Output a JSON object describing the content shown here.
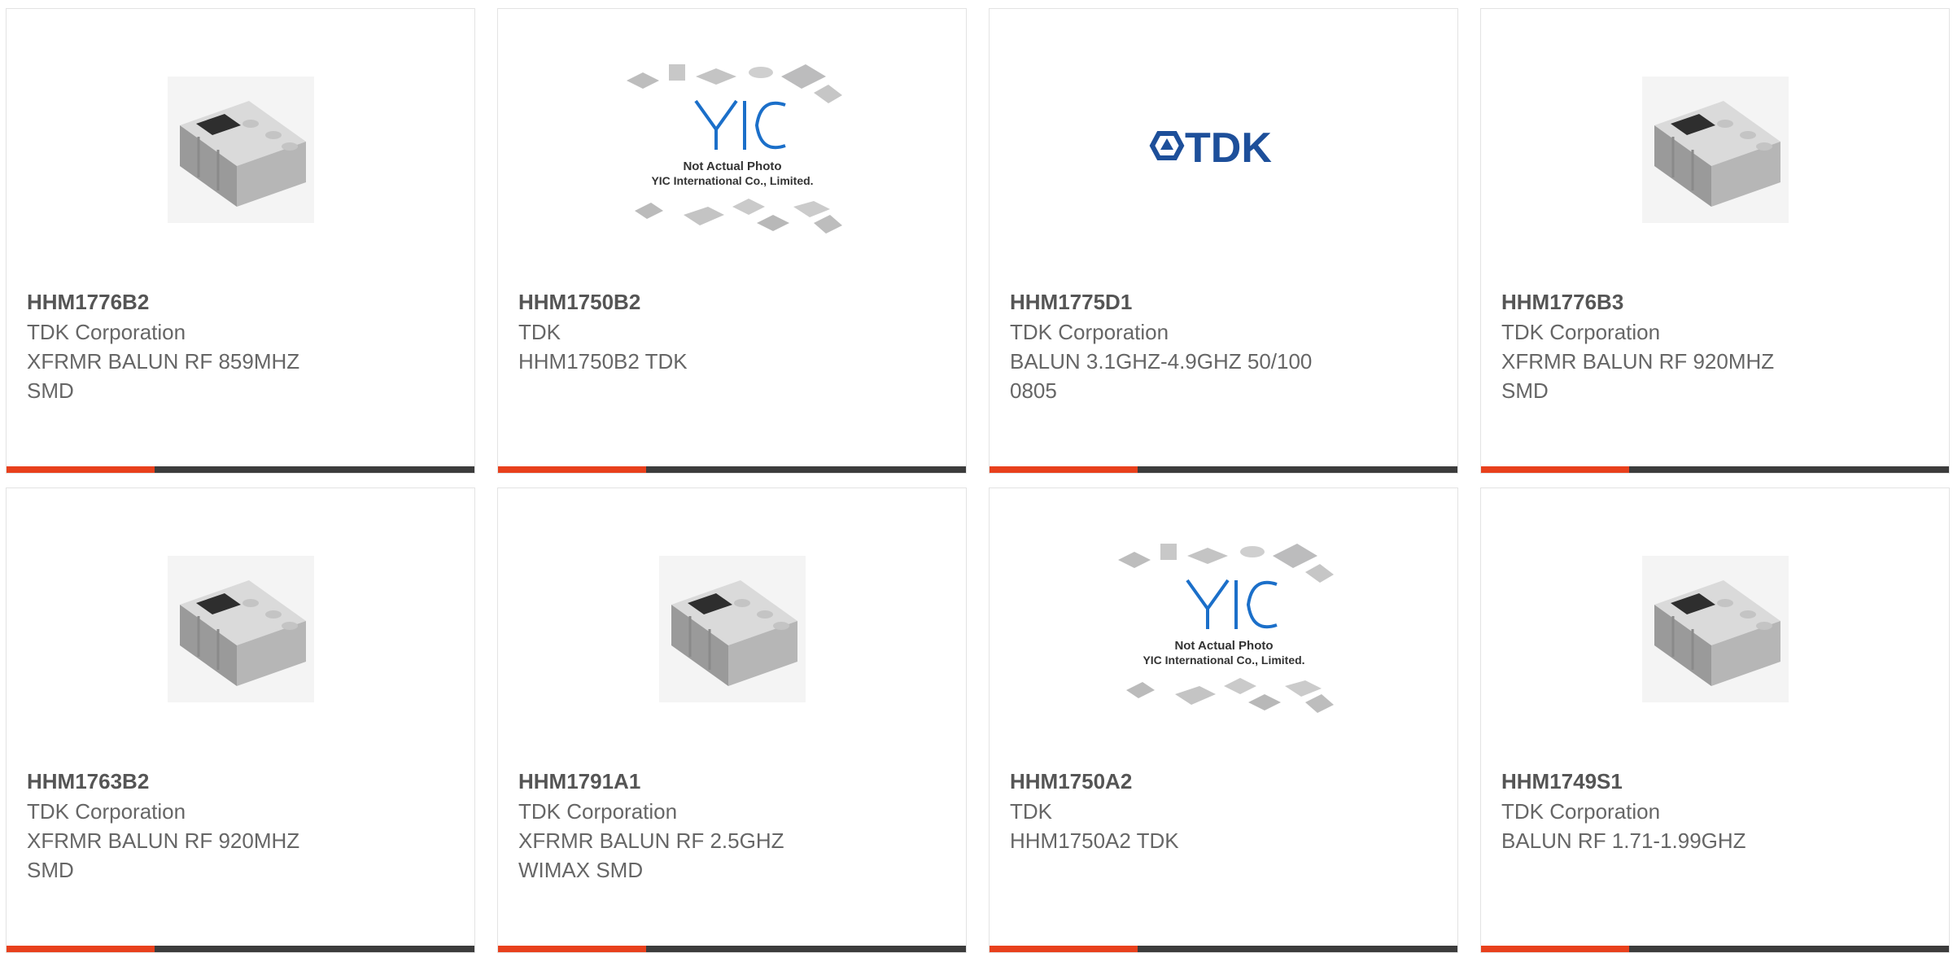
{
  "products": [
    {
      "part": "HHM1776B2",
      "maker": "TDK Corporation",
      "desc1": "XFRMR BALUN RF 859MHZ",
      "desc2": "SMD",
      "image": "component-photo"
    },
    {
      "part": "HHM1750B2",
      "maker": "TDK",
      "desc1": "HHM1750B2 TDK",
      "desc2": "",
      "image": "placeholder-photo"
    },
    {
      "part": "HHM1775D1",
      "maker": "TDK Corporation",
      "desc1": "BALUN 3.1GHZ-4.9GHZ 50/100",
      "desc2": "0805",
      "image": "tdk-logo"
    },
    {
      "part": "HHM1776B3",
      "maker": "TDK Corporation",
      "desc1": "XFRMR BALUN RF 920MHZ",
      "desc2": "SMD",
      "image": "component-photo"
    },
    {
      "part": "HHM1763B2",
      "maker": "TDK Corporation",
      "desc1": "XFRMR BALUN RF 920MHZ",
      "desc2": "SMD",
      "image": "component-photo"
    },
    {
      "part": "HHM1791A1",
      "maker": "TDK Corporation",
      "desc1": "XFRMR BALUN RF 2.5GHZ",
      "desc2": "WIMAX SMD",
      "image": "component-photo"
    },
    {
      "part": "HHM1750A2",
      "maker": "TDK",
      "desc1": "HHM1750A2 TDK",
      "desc2": "",
      "image": "placeholder-photo"
    },
    {
      "part": "HHM1749S1",
      "maker": "TDK Corporation",
      "desc1": "BALUN RF 1.71-1.99GHZ",
      "desc2": "",
      "image": "component-photo"
    }
  ],
  "placeholder": {
    "brand": "YIC",
    "line1": "Not Actual Photo",
    "line2": "YIC International Co., Limited."
  },
  "tdk_logo_text": "TDK",
  "colors": {
    "accent": "#e8401c",
    "bar": "#3c3c3c",
    "tdk_blue": "#1d4f9a",
    "yic_blue": "#1b6fc9"
  }
}
